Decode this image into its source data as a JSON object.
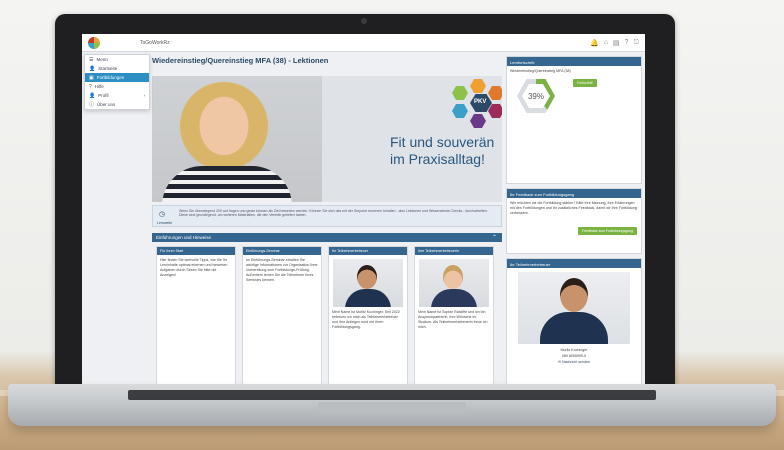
{
  "app": {
    "title": "ToGoWorkRz"
  },
  "menu": {
    "items": [
      {
        "label": "Menü",
        "icon": "menu-icon"
      },
      {
        "label": "Startseite",
        "icon": "user-icon"
      },
      {
        "label": "Fortbildungen",
        "icon": "book-icon"
      },
      {
        "label": "Hilfe",
        "icon": "help-icon"
      },
      {
        "label": "Profil",
        "icon": "user-icon"
      },
      {
        "label": "Über uns",
        "icon": "info-icon"
      }
    ]
  },
  "page": {
    "title": "Wiedereinstieg/Quereinstieg MFA (38) - Lektionen"
  },
  "hero": {
    "slogan_line1": "Fit und souverän",
    "slogan_line2": "im Praxisalltag!",
    "badge": "PKV"
  },
  "notice": {
    "text": "Wenn Sie überwiegend 200 auf fragen und geste können als Ziel bewerten werden. Können Sie sich das mit der Serpoint rrumeren Inhalten - also Lektionen und Wissenstests Checks - durcharbeiten. Diese sind grundlegend, um weiteren Materialien, die den Vertrieb geliefert haben.",
    "label": "Lernweite"
  },
  "section": {
    "title": "Einführungen und Hinweise"
  },
  "cards": [
    {
      "header": "Für Ihren Start",
      "text": "Hier finden Sie wertvolle Tipps, wie Sie Ihr Lerninhalte optimal erlernen und bewerten Aufgaben durch Sesen Sie bitte die Anzeigen!"
    },
    {
      "header": "Einführungs-Seminar",
      "text": "Im Einführungs-Seminar erhalten Sie wichtige Informationen zur Organisation Ihrer Vorbereitung zum Fortbildungs-Prüfung. Außerdem lernen Sie die Teilnehmer Ihres Seminars kennen."
    },
    {
      "header": "Ihr Teilnehmerbetreuer",
      "text": "Mein Name ist Moritz Kuchinger. Seit 2022 betreuen ich mich als Teilnehmerbetreuer und Ihre Anliegen rund um Ihren Fortbildungsgang."
    },
    {
      "header": "Ihre Teilnehmerbetreuerin",
      "text": "Mein Name ist Sophie Ratcliffe und ich bin Ansprechpartnerin, Ihre Wünsche im Studium. Als Teilnehmerbetreuerin freue ich mich."
    }
  ],
  "right": {
    "progress": {
      "header": "Lernfortschritt",
      "course": "Wiedereinstieg/Quereinstieg MFA (38)",
      "button": "Fortschritt",
      "percent": "39%",
      "value": 0.39
    },
    "feedback": {
      "header": "Ihr Feedback zum Fortbildungsgang",
      "text": "Wie möchten wir die Fortbildung stärker? Bitte Ihre Meinung, Ihre Erfahrungen mit den Fortbildungen und Ihr zusätzliches Feedback, damit wir Ihre Fortbildung verbessern.",
      "button": "Feedback zum Fortbildungsgang"
    },
    "tutor": {
      "header": "Ihr Teilnehmerbetreuer",
      "name": "Moritz Kuchinger",
      "phone": "089 8055999-0",
      "link": "Nachricht senden"
    }
  },
  "colors": {
    "accent": "#34668f",
    "green": "#7bb342",
    "title": "#2c4a66"
  }
}
